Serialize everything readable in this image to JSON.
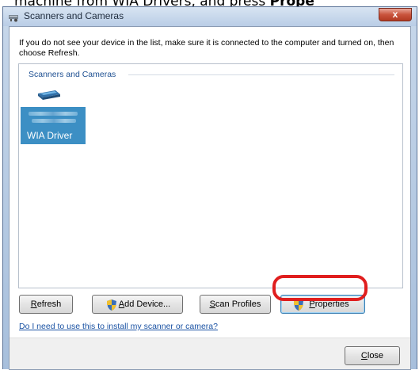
{
  "caption": {
    "prefix": "machine from WIA Drivers, and press ",
    "bold": "Prope"
  },
  "window": {
    "title": "Scanners and Cameras",
    "close_glyph": "x"
  },
  "instructions": "If you do not see your device in the list, make sure it is connected to the computer and turned on, then choose Refresh.",
  "group": {
    "label": "Scanners and Cameras",
    "device": {
      "name": "WIA Driver",
      "icon": "scanner-icon"
    }
  },
  "buttons": {
    "refresh": {
      "underline": "R",
      "rest": "efresh"
    },
    "add_device": {
      "underline": "A",
      "rest": "dd Device..."
    },
    "scan_profiles": {
      "underline": "S",
      "rest": "can Profiles"
    },
    "properties": {
      "underline": "P",
      "rest": "roperties"
    },
    "close": {
      "underline": "C",
      "rest": "lose"
    }
  },
  "help_link": "Do I need to use this to install my scanner or camera?",
  "colors": {
    "selection": "#3c8fc4",
    "link": "#1a52a3",
    "highlight": "#e01e1e"
  }
}
